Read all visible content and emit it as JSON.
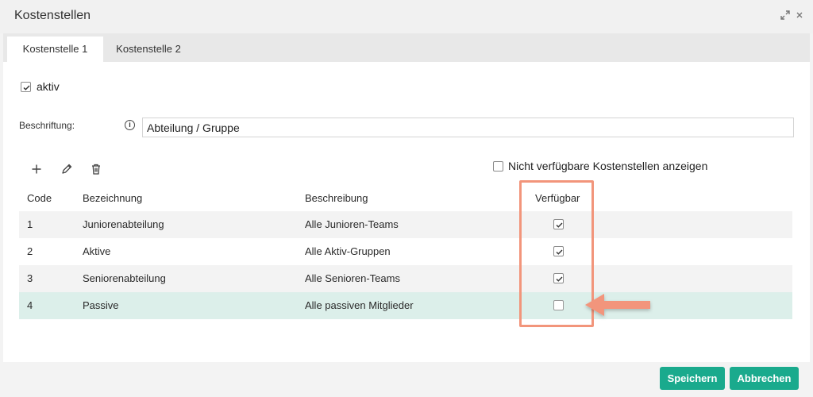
{
  "dialog": {
    "title": "Kostenstellen",
    "expand_icon": "expand-icon",
    "close_icon": "close-icon"
  },
  "tabs": [
    {
      "label": "Kostenstelle 1",
      "active": true
    },
    {
      "label": "Kostenstelle 2",
      "active": false
    }
  ],
  "form": {
    "aktiv_label": "aktiv",
    "aktiv_checked": true,
    "beschriftung_label": "Beschriftung:",
    "beschriftung_value": "Abteilung / Gruppe"
  },
  "toolbar": {
    "icons": [
      "plus-icon",
      "pencil-icon",
      "trash-icon"
    ],
    "show_unavailable_label": "Nicht verfügbare Kostenstellen anzeigen",
    "show_unavailable_checked": false
  },
  "table": {
    "columns": [
      "Code",
      "Bezeichnung",
      "Beschreibung",
      "Verfügbar"
    ],
    "rows": [
      {
        "code": "1",
        "bezeichnung": "Juniorenabteilung",
        "beschreibung": "Alle Junioren-Teams",
        "verfuegbar": true
      },
      {
        "code": "2",
        "bezeichnung": "Aktive",
        "beschreibung": "Alle Aktiv-Gruppen",
        "verfuegbar": true
      },
      {
        "code": "3",
        "bezeichnung": "Seniorenabteilung",
        "beschreibung": "Alle Senioren-Teams",
        "verfuegbar": true
      },
      {
        "code": "4",
        "bezeichnung": "Passive",
        "beschreibung": "Alle passiven Mitglieder",
        "verfuegbar": false
      }
    ],
    "selected_row": 3
  },
  "footer": {
    "save_label": "Speichern",
    "cancel_label": "Abbrechen"
  },
  "colors": {
    "accent": "#1aaa8d",
    "selected_row": "#dcefea",
    "annotation": "#f2957b"
  }
}
